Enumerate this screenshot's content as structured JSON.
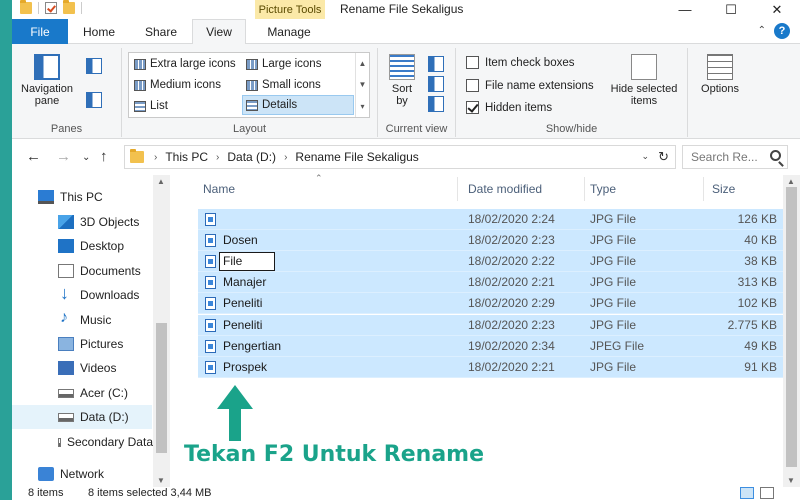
{
  "window": {
    "title": "Rename File Sekaligus",
    "context_tab": "Picture Tools",
    "controls": {
      "minimize": "—",
      "maximize": "☐",
      "close": "✕"
    }
  },
  "ribbon_tabs": {
    "file": "File",
    "home": "Home",
    "share": "Share",
    "view": "View",
    "manage": "Manage",
    "help": "?"
  },
  "ribbon": {
    "panes": {
      "label": "Panes",
      "navigation_pane": "Navigation pane"
    },
    "layout": {
      "label": "Layout",
      "items": {
        "extra_large": "Extra large icons",
        "large": "Large icons",
        "medium": "Medium icons",
        "small": "Small icons",
        "list": "List",
        "details": "Details"
      }
    },
    "current_view": {
      "label": "Current view",
      "sort_by": "Sort by"
    },
    "show_hide": {
      "label": "Show/hide",
      "item_check_boxes": "Item check boxes",
      "file_name_extensions": "File name extensions",
      "hidden_items": "Hidden items",
      "hide_selected": "Hide selected items",
      "options": "Options"
    }
  },
  "address": {
    "crumbs": [
      "This PC",
      "Data  (D:)",
      "Rename File Sekaligus"
    ],
    "search_placeholder": "Search Re..."
  },
  "sidebar": {
    "items": [
      {
        "label": "This PC",
        "icon": "pc-icon"
      },
      {
        "label": "3D Objects",
        "icon": "3d-objects-icon"
      },
      {
        "label": "Desktop",
        "icon": "desktop-icon"
      },
      {
        "label": "Documents",
        "icon": "documents-icon"
      },
      {
        "label": "Downloads",
        "icon": "downloads-icon"
      },
      {
        "label": "Music",
        "icon": "music-icon"
      },
      {
        "label": "Pictures",
        "icon": "pictures-icon"
      },
      {
        "label": "Videos",
        "icon": "videos-icon"
      },
      {
        "label": "Acer (C:)",
        "icon": "drive-icon"
      },
      {
        "label": "Data  (D:)",
        "icon": "drive-icon"
      },
      {
        "label": "Secondary Data",
        "icon": "drive-icon"
      },
      {
        "label": "Network",
        "icon": "network-icon"
      }
    ]
  },
  "file_list": {
    "columns": {
      "name": "Name",
      "date": "Date modified",
      "type": "Type",
      "size": "Size"
    },
    "rows": [
      {
        "name": "",
        "date": "18/02/2020 2:24",
        "type": "JPG File",
        "size": "126 KB"
      },
      {
        "name": "Dosen",
        "date": "18/02/2020 2:23",
        "type": "JPG File",
        "size": "40 KB"
      },
      {
        "name": "File",
        "date": "18/02/2020 2:22",
        "type": "JPG File",
        "size": "38 KB"
      },
      {
        "name": "Manajer",
        "date": "18/02/2020 2:21",
        "type": "JPG File",
        "size": "313 KB"
      },
      {
        "name": "Peneliti",
        "date": "18/02/2020 2:29",
        "type": "JPG File",
        "size": "102 KB"
      },
      {
        "name": "Peneliti",
        "date": "18/02/2020 2:23",
        "type": "JPG File",
        "size": "2.775 KB"
      },
      {
        "name": "Pengertian",
        "date": "19/02/2020 2:34",
        "type": "JPEG File",
        "size": "49 KB"
      },
      {
        "name": "Prospek",
        "date": "18/02/2020 2:21",
        "type": "JPG File",
        "size": "91 KB"
      }
    ],
    "rename_value": "File"
  },
  "annotation": "Tekan F2 Untuk Rename",
  "status": {
    "items": "8 items",
    "selected": "8 items selected  3,44 MB"
  },
  "colors": {
    "background_accent": "#2aa198",
    "file_tab": "#1979ca",
    "selection": "#cce8ff",
    "annotation": "#1aa38a"
  }
}
